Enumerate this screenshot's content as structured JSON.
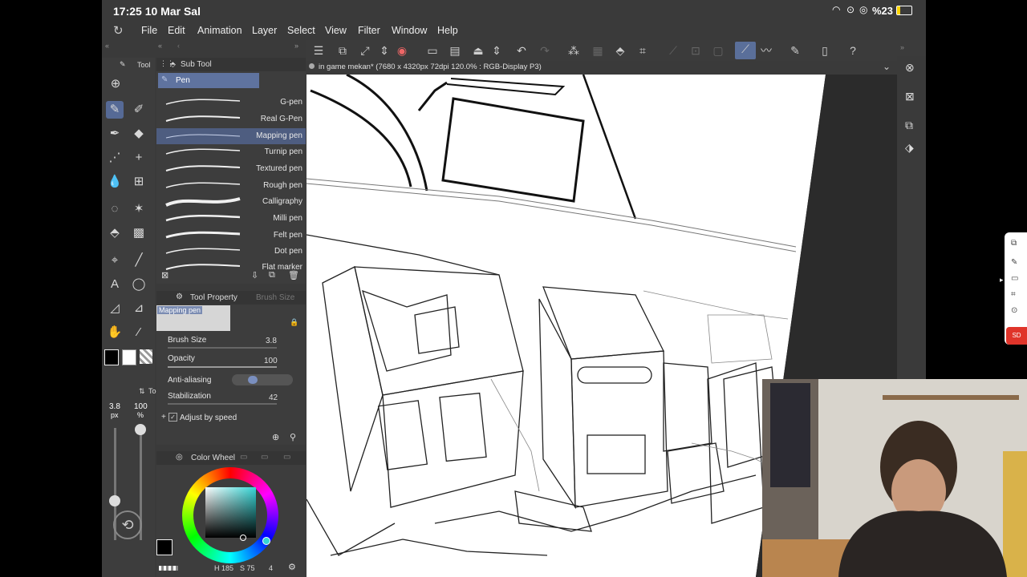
{
  "status": {
    "time_date": "17:25  10 Mar Sal",
    "battery": "%23"
  },
  "menu": {
    "items": [
      "File",
      "Edit",
      "Animation",
      "Layer",
      "Select",
      "View",
      "Filter",
      "Window",
      "Help"
    ]
  },
  "document": {
    "title": "in game mekan* (7680 x 4320px 72dpi 120.0% : RGB-Display P3)"
  },
  "tool_tabs": {
    "tool": "Tool",
    "subtool": "Sub Tool"
  },
  "subtool": {
    "group": "Pen",
    "brushes": [
      "G-pen",
      "Real G-Pen",
      "Mapping pen",
      "Turnip pen",
      "Textured pen",
      "Rough pen",
      "Calligraphy",
      "Milli pen",
      "Felt pen",
      "Dot pen",
      "Flat marker"
    ],
    "selected_index": 2
  },
  "tool_property": {
    "tab": "Tool Property",
    "tab2": "Brush Size",
    "preview_label": "Mapping pen",
    "brush_size_label": "Brush Size",
    "brush_size": "3.8",
    "opacity_label": "Opacity",
    "opacity": "100",
    "anti_alias_label": "Anti-aliasing",
    "stabilization_label": "Stabilization",
    "stabilization": "42",
    "adjust_label": "Adjust by speed"
  },
  "mini_panel": {
    "label": "Tool",
    "size": "3.8",
    "size_unit": "px",
    "opacity": "100",
    "opacity_unit": "%"
  },
  "color_wheel": {
    "label": "Color Wheel",
    "h": "185",
    "s": "75",
    "v": "4",
    "hue_color": "#36d6d6"
  },
  "float_badge": "SD"
}
